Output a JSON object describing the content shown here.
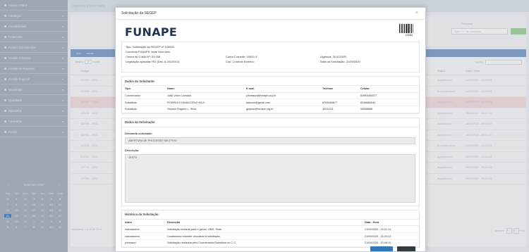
{
  "sidebar": {
    "items": [
      {
        "label": "Acesso Online"
      },
      {
        "label": "Captação"
      },
      {
        "label": "Contabilidade"
      },
      {
        "label": "Financeiro"
      },
      {
        "label": "Gerenc.Documentos"
      },
      {
        "label": "Gestão Compras"
      },
      {
        "label": "Gestão de Pessoas"
      },
      {
        "label": "Gestão Projetos"
      },
      {
        "label": "Newsletter"
      },
      {
        "label": "Qualidade"
      },
      {
        "label": "Relatórios"
      },
      {
        "label": "Cadastros"
      },
      {
        "label": "Gerais"
      }
    ],
    "calendar": {
      "title": "Setembro 2020",
      "weekdays": [
        "Seg",
        "Ter",
        "Qua",
        "Qui",
        "Sex",
        "Sab",
        "Dom"
      ],
      "weeks": [
        [
          "31",
          "1",
          "2",
          "3",
          "4",
          "5",
          "6"
        ],
        [
          "7",
          "8",
          "9",
          "10",
          "11",
          "12",
          "13"
        ],
        [
          "14",
          "15",
          "16",
          "17",
          "18",
          "19",
          "20"
        ],
        [
          "21",
          "22",
          "23",
          "24",
          "25",
          "26",
          "27"
        ],
        [
          "28",
          "29",
          "30",
          "1",
          "2",
          "3",
          "4"
        ],
        [
          "5",
          "6",
          "7",
          "8",
          "9",
          "10",
          "11"
        ]
      ],
      "selected": "21"
    }
  },
  "background": {
    "topbar_text": "Legenda (clique para",
    "pesquisa_label": "Pesquisa",
    "pesquisa_placeholder": "digite o nº da solicitação",
    "tabs": [
      "abrl",
      "arocs"
    ],
    "mostrar_label": "Mostrar",
    "mostrar_value": "10",
    "registros_label": "registr",
    "busca_label": "Busca:",
    "col_codigo": "Código",
    "col_status": "Status",
    "col_data": "Data / Hora",
    "rows": [
      {
        "code": "120050 - 2020",
        "status": "Aguardando",
        "date": "21/09/2020 - 10:53:54",
        "hl": false
      },
      {
        "code": "120055 - 2020",
        "status": "Em Andamento",
        "date": "21/09/2020 - 10:49:15",
        "hl": false
      },
      {
        "code": "120040 - 2020",
        "status": "Aguardando",
        "date": "18/09/2020 - 08:40:43",
        "hl": true
      },
      {
        "code": "120035 - 2020",
        "status": "Aguardando",
        "date": "18/09/2020 - 08:21:30",
        "hl": false
      },
      {
        "code": "120036 - 2020",
        "status": "Aguardando",
        "date": "18/09/2020 - 08:15:59",
        "hl": false
      },
      {
        "code": "120032 - 2020",
        "status": "Aguardando",
        "date": "18/09/2020 - 08:11:47",
        "hl": false
      },
      {
        "code": "120024 - 2020",
        "status": "Em Andamento",
        "date": "21/09/2020 - 10:19:23",
        "hl": false
      },
      {
        "code": "118135 - 2020",
        "status": "Aguardando",
        "date": "28/07/2020 - 10:29:42",
        "hl": false
      },
      {
        "code": "117775 - 2020",
        "status": "Aguardando",
        "date": "23/07/2020 - 09:15:49",
        "hl": false
      },
      {
        "code": "117768 - 2020",
        "status": "Aguardando",
        "date": "23/07/2020 - 09:12:10",
        "hl": false
      }
    ],
    "footer_text": "Mostrando 1 a 10 de 19 re",
    "pag_prev": "Anterior",
    "pag_current": "1",
    "pag_page2": "2",
    "pag_next": "Próx"
  },
  "modal": {
    "title": "Solicitação da SEGEP",
    "close": "×",
    "logo_text": "FUNAPE",
    "barcode_number": "120054",
    "info": {
      "tipo": "Tipo: Solicitação da SEGEP nº 120054",
      "convenio": "Convênio FUNAPE: teste html view",
      "centro": "Centro de Custo Nº: 01.008",
      "conta": "Conta Corrente: 19500-X",
      "vigencia": "Vigência: 31/12/2020",
      "legislacao": "Legislação aplicada: RG (Dec. 8.241/2014)",
      "controle": "Cod. Controle Externo:",
      "data_sol": "Data da Solicitação: 21/09/2020"
    },
    "solicitante": {
      "title": "Dados do Solicitante:",
      "headers": [
        "Tipo",
        "Nome",
        "E-mail",
        "Telefone",
        "Celular"
      ],
      "rows": [
        [
          "Coordenador",
          "João Victor Lomazzi",
          "jvlomazzi@funape.org.br",
          "",
          "62981683377"
        ],
        [
          "Substituto",
          "RODRIGO DAMASCENO KAJI",
          "kajimoo@gmail.com",
          "8295446877",
          "8298685544"
        ],
        [
          "Substituto",
          "Geyson Rogério L. Silva",
          "geyson@funape.org.br",
          "35211111",
          "99988888"
        ]
      ]
    },
    "solicitacao": {
      "title": "Dados da Solicitação:",
      "demanda_label": "Demanda solicitada:",
      "demanda_value": "ABERTURA DE PROCESSO SELETIVO",
      "descricao_label": "Descrição:",
      "descricao_value": "TESTE"
    },
    "historico": {
      "title": "Histórico da Solicitação:",
      "headers": [
        "Autor",
        "Descrição",
        "Data - Hora"
      ],
      "rows": [
        [
          "rdamasceno",
          "Solicitação enviada para o gestor. OBS: Teste",
          "21/09/2020 - 14:21:14"
        ],
        [
          "rdamasceno",
          "Colaborador rusnider vinculado à solicitação.",
          "21/09/2020 - 14:20:13"
        ],
        [
          "jvlomazzi",
          "Solicitação realizada pelo Coordenador/Substituto do C.C.",
          "21/09/2020 - 10:46:10"
        ]
      ]
    }
  }
}
